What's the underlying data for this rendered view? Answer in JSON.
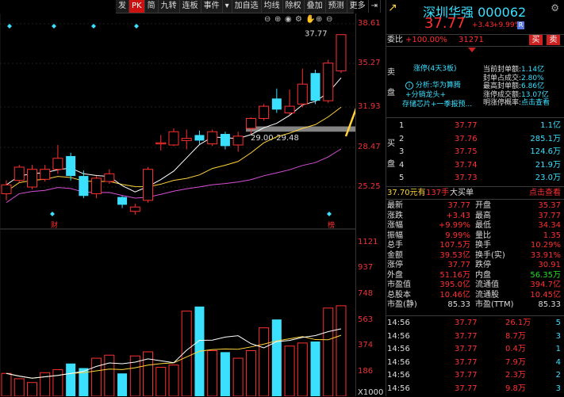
{
  "toolbar": [
    "发",
    "PK",
    "简",
    "九转",
    "连板",
    "事件",
    "加自选",
    "均线",
    "除权",
    "叠加",
    "预测",
    "更多"
  ],
  "toolbar_icons": [
    "dropdown-icon",
    "dropdown-icon",
    "exit-icon",
    "dropdown-icon"
  ],
  "chart_icons": [
    "zoom-out-icon",
    "zoom-in-icon",
    "eye-icon",
    "settings-icon",
    "hand-icon",
    "plus-icon",
    "minus-icon"
  ],
  "price_labels": [
    "38.61",
    "35.27",
    "31.93",
    "28.47",
    "25.25"
  ],
  "volume_labels": [
    "1121",
    "937",
    "748",
    "563",
    "374",
    "186",
    "X1000"
  ],
  "high_label": "37.77",
  "support_label": "29.00-29.48",
  "event_marks": [
    "财",
    "榜"
  ],
  "stock": {
    "name": "深圳华强",
    "code": "000062",
    "price": "37.77",
    "change": "+3.43",
    "change_pct": "+9.99%",
    "r_badge": "R"
  },
  "weibi": {
    "label": "委比",
    "value": "+100.00%",
    "weicha": "31271",
    "buy": "买",
    "sell": "卖"
  },
  "sell_side": "卖\n盘",
  "limit_info": {
    "title": "涨停(4天3板)",
    "analysis": "分析:华为算腾",
    "tags": [
      "+分销龙头+",
      "存储芯片+一季报预..."
    ],
    "metrics": [
      {
        "k": "当前封单额:",
        "v": "1.14亿"
      },
      {
        "k": "封单占成交:",
        "v": "2.80%"
      },
      {
        "k": "最高封单额:",
        "v": "6.86亿"
      },
      {
        "k": "涨停成交额:",
        "v": "13.07亿"
      },
      {
        "k": "明涨停概率:",
        "v": "点击查看"
      }
    ]
  },
  "buy_side": "买\n盘",
  "bids": [
    {
      "n": "1",
      "p": "37.77",
      "v": "1.1亿"
    },
    {
      "n": "2",
      "p": "37.76",
      "v": "285.1万"
    },
    {
      "n": "3",
      "p": "37.75",
      "v": "124.6万"
    },
    {
      "n": "4",
      "p": "37.74",
      "v": "21.9万"
    },
    {
      "n": "5",
      "p": "37.73",
      "v": "23.0万"
    }
  ],
  "big_order": {
    "price": "37.70元有",
    "qty": "137手",
    "label": "大买单",
    "link": "点击查看"
  },
  "stats": [
    [
      "最新",
      "37.77",
      "开盘",
      "35.37"
    ],
    [
      "涨跌",
      "+3.43",
      "最高",
      "37.77"
    ],
    [
      "涨幅",
      "+9.99%",
      "最低",
      "34.34"
    ],
    [
      "振幅",
      "9.99%",
      "量比",
      "1.35"
    ],
    [
      "总手",
      "107.5万",
      "换手",
      "10.29%"
    ],
    [
      "金额",
      "39.53亿",
      "换手(实)",
      "33.91%"
    ],
    [
      "涨停",
      "37.77",
      "跌停",
      "30.91"
    ],
    [
      "外盘",
      "51.16万",
      "内盘",
      "56.35万"
    ],
    [
      "市盈值",
      "395.0亿",
      "流通值",
      "394.7亿"
    ],
    [
      "总股本",
      "10.46亿",
      "流通股",
      "10.45亿"
    ],
    [
      "市盈(静)",
      "85.33",
      "市盈(TTM)",
      "85.33"
    ]
  ],
  "ticks": [
    [
      "14:56",
      "37.77",
      "26.1万",
      "5"
    ],
    [
      "14:56",
      "37.77",
      "8.7万",
      "3"
    ],
    [
      "14:56",
      "37.77",
      "0.4万",
      "1"
    ],
    [
      "14:56",
      "37.77",
      "7.9万",
      "4"
    ],
    [
      "14:56",
      "37.77",
      "2.3万",
      "2"
    ],
    [
      "14:56",
      "37.77",
      "9.8万",
      "3"
    ]
  ],
  "colors": {
    "up": "#ff3030",
    "down": "#3be0ff",
    "ma5": "#ffffff",
    "ma10": "#ffd23a",
    "ma20": "#d64fd6"
  },
  "chart_data": {
    "type": "candlestick",
    "ylim": [
      22.5,
      38.61
    ],
    "candles": [
      {
        "o": 23.4,
        "c": 24.2,
        "h": 24.6,
        "l": 22.8
      },
      {
        "o": 24.6,
        "c": 25.8,
        "h": 26.0,
        "l": 24.4
      },
      {
        "o": 24.0,
        "c": 25.6,
        "h": 26.0,
        "l": 23.8
      },
      {
        "o": 24.7,
        "c": 25.6,
        "h": 26.0,
        "l": 24.5
      },
      {
        "o": 25.6,
        "c": 26.6,
        "h": 27.8,
        "l": 25.2
      },
      {
        "o": 26.8,
        "c": 25.0,
        "h": 27.1,
        "l": 24.6
      },
      {
        "o": 25.0,
        "c": 23.2,
        "h": 25.5,
        "l": 23.0
      },
      {
        "o": 23.4,
        "c": 24.8,
        "h": 25.0,
        "l": 23.0
      },
      {
        "o": 24.5,
        "c": 25.2,
        "h": 25.6,
        "l": 24.3
      },
      {
        "o": 23.1,
        "c": 22.4,
        "h": 23.2,
        "l": 22.1
      },
      {
        "o": 21.8,
        "c": 22.2,
        "h": 22.5,
        "l": 21.5
      },
      {
        "o": 22.8,
        "c": 25.6,
        "h": 25.8,
        "l": 22.6
      },
      {
        "o": 27.9,
        "c": 28.0,
        "h": 28.7,
        "l": 27.3
      },
      {
        "o": 27.8,
        "c": 29.0,
        "h": 29.3,
        "l": 27.7
      },
      {
        "o": 28.2,
        "c": 28.4,
        "h": 29.2,
        "l": 27.4
      },
      {
        "o": 28.7,
        "c": 28.2,
        "h": 29.1,
        "l": 27.9
      },
      {
        "o": 27.9,
        "c": 29.0,
        "h": 29.2,
        "l": 27.7
      },
      {
        "o": 28.8,
        "c": 27.7,
        "h": 29.0,
        "l": 27.4
      },
      {
        "o": 27.8,
        "c": 28.6,
        "h": 29.0,
        "l": 27.2
      },
      {
        "o": 29.3,
        "c": 30.2,
        "h": 30.3,
        "l": 28.8
      },
      {
        "o": 30.2,
        "c": 31.3,
        "h": 31.5,
        "l": 30.0
      },
      {
        "o": 32.0,
        "c": 31.0,
        "h": 32.9,
        "l": 30.7
      },
      {
        "o": 30.7,
        "c": 31.3,
        "h": 32.8,
        "l": 30.5
      },
      {
        "o": 31.5,
        "c": 33.3,
        "h": 34.7,
        "l": 31.2
      },
      {
        "o": 34.3,
        "c": 31.8,
        "h": 34.6,
        "l": 31.5
      },
      {
        "o": 31.8,
        "c": 35.2,
        "h": 35.5,
        "l": 31.6
      },
      {
        "o": 34.5,
        "c": 37.77,
        "h": 37.77,
        "l": 34.3
      }
    ],
    "volume": [
      150,
      115,
      90,
      155,
      175,
      215,
      185,
      250,
      270,
      150,
      265,
      292,
      190,
      205,
      560,
      590,
      300,
      290,
      250,
      300,
      450,
      505,
      330,
      350,
      360,
      580,
      595
    ],
    "volume_ylim": [
      0,
      1121
    ]
  }
}
